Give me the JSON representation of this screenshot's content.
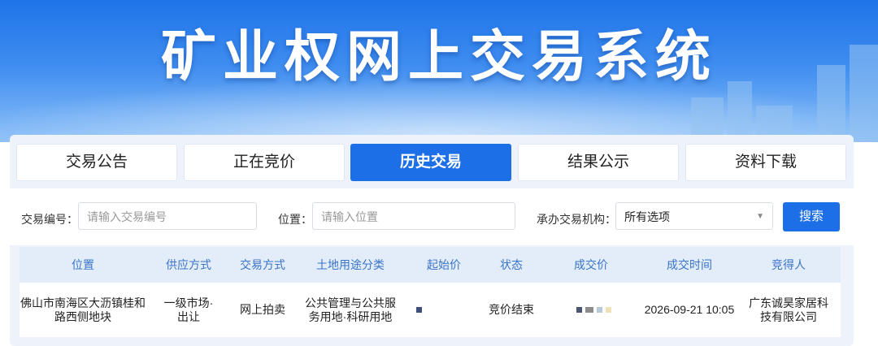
{
  "banner": {
    "title": "矿业权网上交易系统"
  },
  "tabs": [
    {
      "label": "交易公告",
      "active": false
    },
    {
      "label": "正在竞价",
      "active": false
    },
    {
      "label": "历史交易",
      "active": true
    },
    {
      "label": "结果公示",
      "active": false
    },
    {
      "label": "资料下载",
      "active": false
    }
  ],
  "filters": {
    "trade_no": {
      "label": "交易编号：",
      "placeholder": "请输入交易编号"
    },
    "location": {
      "label": "位置：",
      "placeholder": "请输入位置"
    },
    "agency": {
      "label": "承办交易机构：",
      "value": "所有选项"
    },
    "search_label": "搜索"
  },
  "table": {
    "headers": [
      "位置",
      "供应方式",
      "交易方式",
      "土地用途分类",
      "起始价",
      "状态",
      "成交价",
      "成交时间",
      "竞得人"
    ],
    "rows": [
      {
        "location": "佛山市南海区大沥镇桂和路西侧地块",
        "supply": "一级市场·出让",
        "method": "网上拍卖",
        "use": "公共管理与公共服务用地·科研用地",
        "status": "竞价结束",
        "time": "2026-09-21 10:05",
        "winner": "广东诚昊家居科技有限公司"
      }
    ]
  },
  "colors": {
    "accent": "#1c6fe6",
    "header_text": "#3a74c8",
    "header_bg": "#e3edf9"
  }
}
